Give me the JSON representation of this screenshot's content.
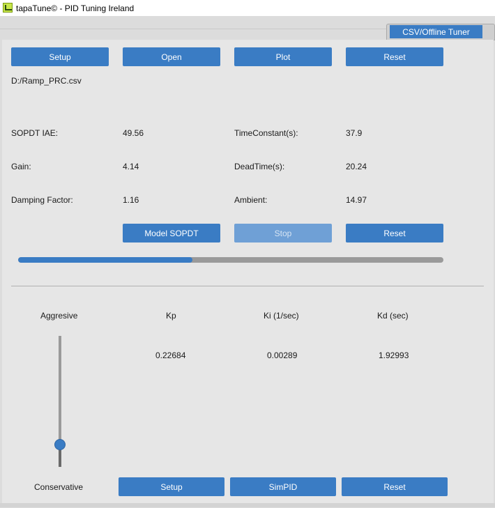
{
  "window": {
    "title": "tapaTune© - PID Tuning Ireland"
  },
  "tabs": [
    {
      "label": "CSV/Offline Tuner"
    }
  ],
  "toolbar": {
    "setup": "Setup",
    "open": "Open",
    "plot": "Plot",
    "reset": "Reset"
  },
  "file_path": "D:/Ramp_PRC.csv",
  "model": {
    "iae_label": "SOPDT IAE:",
    "iae_value": "49.56",
    "timeconstant_label": "TimeConstant(s):",
    "timeconstant_value": "37.9",
    "gain_label": "Gain:",
    "gain_value": "4.14",
    "deadtime_label": "DeadTime(s):",
    "deadtime_value": "20.24",
    "damping_label": "Damping Factor:",
    "damping_value": "1.16",
    "ambient_label": "Ambient:",
    "ambient_value": "14.97",
    "model_button": "Model SOPDT",
    "stop_button": "Stop",
    "reset_button": "Reset",
    "progress_fraction": 0.41
  },
  "pid": {
    "aggressive_label": "Aggresive",
    "conservative_label": "Conservative",
    "kp_label": "Kp",
    "kp_value": "0.22684",
    "ki_label": "Ki (1/sec)",
    "ki_value": "0.00289",
    "kd_label": "Kd (sec)",
    "kd_value": "1.92993",
    "slider_fraction": 0.17,
    "setup_button": "Setup",
    "simpid_button": "SimPID",
    "reset_button": "Reset"
  },
  "colors": {
    "accent": "#3a7cc4",
    "track": "#9a9a9a"
  },
  "icons": {
    "app": "tapatune-app-icon"
  }
}
